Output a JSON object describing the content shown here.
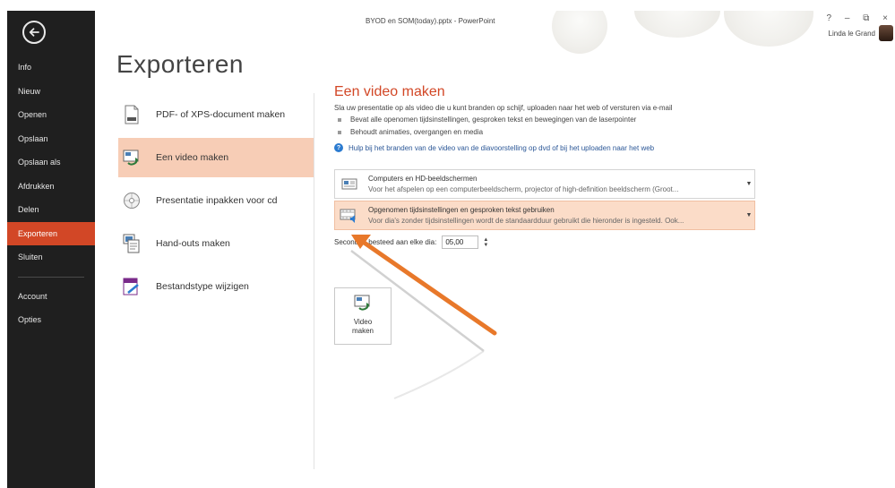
{
  "window": {
    "title": "BYOD en SOM(today).pptx - PowerPoint",
    "controls": "? – ⧉ ×",
    "user_name": "Linda le Grand"
  },
  "sidebar": {
    "items": [
      {
        "label": "Info"
      },
      {
        "label": "Nieuw"
      },
      {
        "label": "Openen"
      },
      {
        "label": "Opslaan"
      },
      {
        "label": "Opslaan als"
      },
      {
        "label": "Afdrukken"
      },
      {
        "label": "Delen"
      },
      {
        "label": "Exporteren",
        "active": true
      },
      {
        "label": "Sluiten"
      },
      {
        "label": "Account"
      },
      {
        "label": "Opties"
      }
    ]
  },
  "page_title": "Exporteren",
  "export_options": [
    {
      "label": "PDF- of XPS-document maken",
      "icon": "pdf-document-icon"
    },
    {
      "label": "Een video maken",
      "icon": "video-icon",
      "active": true
    },
    {
      "label": "Presentatie inpakken voor cd",
      "icon": "cd-icon"
    },
    {
      "label": "Hand-outs maken",
      "icon": "handouts-icon"
    },
    {
      "label": "Bestandstype wijzigen",
      "icon": "file-type-icon"
    }
  ],
  "video_panel": {
    "title": "Een video maken",
    "description": "Sla uw presentatie op als video die u kunt branden op schijf, uploaden naar het web of versturen via e-mail",
    "bullets": [
      "Bevat alle openomen tijdsinstellingen, gesproken tekst en bewegingen van de laserpointer",
      "Behoudt animaties, overgangen en media"
    ],
    "help_link": "Hulp bij het branden van de video van de diavoorstelling op dvd of bij het uploaden naar het web",
    "quality_dropdown": {
      "title": "Computers en HD-beeldschermen",
      "subtitle": "Voor het afspelen op een computerbeeldscherm, projector of high-definition beeldscherm (Groot..."
    },
    "timing_dropdown": {
      "title": "Opgenomen tijdsinstellingen en gesproken tekst gebruiken",
      "subtitle": "Voor dia's zonder tijdsinstellingen wordt de standaardduur gebruikt die hieronder is ingesteld. Ook..."
    },
    "seconds_label": "Seconden besteed aan elke dia:",
    "seconds_value": "05,00",
    "create_button": "Video maken"
  },
  "colors": {
    "accent": "#d24726",
    "sidebar_bg": "#1f1f1f",
    "highlight": "#f7cdb6",
    "arrow": "#e8782a"
  }
}
